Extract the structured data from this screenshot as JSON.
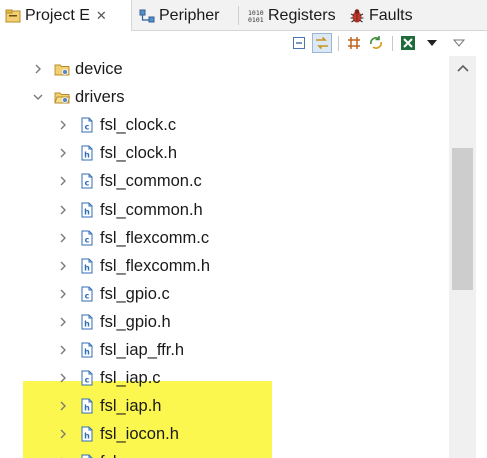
{
  "tabs": [
    {
      "label": "Project E",
      "icon": "project-explorer-icon",
      "close": "✕",
      "active": true
    },
    {
      "label": "Peripher",
      "icon": "peripherals-icon"
    },
    {
      "label": "Registers",
      "icon": "registers-icon"
    },
    {
      "label": "Faults",
      "icon": "faults-bug-icon"
    }
  ],
  "toolbar": {
    "buttons": [
      "collapse-all-icon",
      "link-with-editor-icon",
      "grid-icon",
      "sync-icon",
      "filter-icon",
      "view-menu-icon",
      "minimize-icon"
    ]
  },
  "tree": {
    "items": [
      {
        "label": "device",
        "type": "folder",
        "expanded": false,
        "depth": 0
      },
      {
        "label": "drivers",
        "type": "folder",
        "expanded": true,
        "depth": 0
      },
      {
        "label": "fsl_clock.c",
        "type": "c-file",
        "depth": 1
      },
      {
        "label": "fsl_clock.h",
        "type": "h-file",
        "depth": 1
      },
      {
        "label": "fsl_common.c",
        "type": "c-file",
        "depth": 1
      },
      {
        "label": "fsl_common.h",
        "type": "h-file",
        "depth": 1
      },
      {
        "label": "fsl_flexcomm.c",
        "type": "c-file",
        "depth": 1
      },
      {
        "label": "fsl_flexcomm.h",
        "type": "h-file",
        "depth": 1
      },
      {
        "label": "fsl_gpio.c",
        "type": "c-file",
        "depth": 1
      },
      {
        "label": "fsl_gpio.h",
        "type": "h-file",
        "depth": 1
      },
      {
        "label": "fsl_iap_ffr.h",
        "type": "h-file",
        "depth": 1,
        "highlighted": true
      },
      {
        "label": "fsl_iap.c",
        "type": "c-file",
        "depth": 1,
        "highlighted": true
      },
      {
        "label": "fsl_iap.h",
        "type": "h-file",
        "depth": 1,
        "highlighted": true
      },
      {
        "label": "fsl_iocon.h",
        "type": "h-file",
        "depth": 1
      },
      {
        "label": "fsl_",
        "type": "c-file",
        "depth": 1
      }
    ]
  },
  "colors": {
    "highlight": "#fbf74f",
    "file_icon_blue": "#2f6db5",
    "folder_yellow": "#e9c46a"
  }
}
